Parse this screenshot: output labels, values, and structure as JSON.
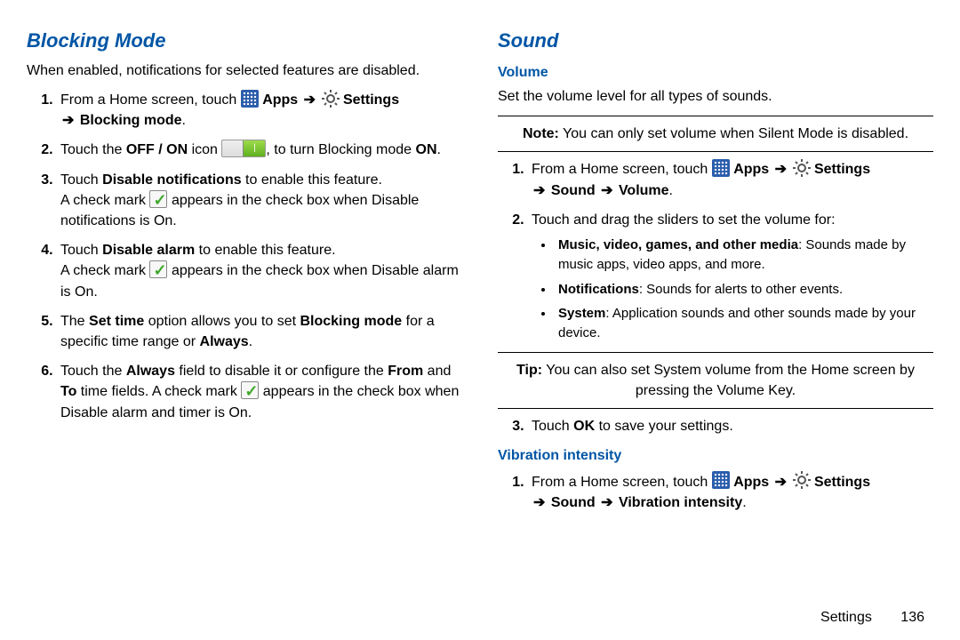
{
  "left": {
    "heading": "Blocking Mode",
    "intro": "When enabled, notifications for selected features are disabled.",
    "steps": {
      "s1a": "From a Home screen, touch ",
      "s1_apps": "Apps",
      "s1_settings": "Settings",
      "s1b": "Blocking mode",
      "s2a": "Touch the ",
      "s2_offon": "OFF / ON",
      "s2b": " icon ",
      "s2c": ", to turn Blocking mode ",
      "s2_on": "ON",
      "s3a": "Touch ",
      "s3_disable_notif": "Disable notifications",
      "s3b": " to enable this feature.",
      "s3c": "A check mark ",
      "s3d": " appears in the check box when Disable notifications is On.",
      "s4a": "Touch ",
      "s4_disable_alarm": "Disable alarm",
      "s4b": " to enable this feature.",
      "s4c": "A check mark ",
      "s4d": " appears in the check box when Disable alarm is On.",
      "s5a": "The ",
      "s5_settime": "Set time",
      "s5b": " option allows you to set ",
      "s5_bm": "Blocking mode",
      "s5c": " for a specific time range or ",
      "s5_always": "Always",
      "s6a": "Touch the ",
      "s6_always": "Always",
      "s6b": " field to disable it or configure the ",
      "s6_from": "From",
      "s6c": " and ",
      "s6_to": "To",
      "s6d": " time fields. A check mark ",
      "s6e": " appears in the check box when Disable alarm and timer is On."
    }
  },
  "right": {
    "heading": "Sound",
    "volume_heading": "Volume",
    "volume_intro": "Set the volume level for all types of sounds.",
    "note_label": "Note:",
    "note_text": " You can only set volume when Silent Mode is disabled.",
    "steps": {
      "s1a": "From a Home screen, touch ",
      "s1_apps": "Apps",
      "s1_settings": "Settings",
      "s1_sound": "Sound",
      "s1_volume": "Volume",
      "s2": "Touch and drag the sliders to set the volume for:",
      "b1_label": "Music, video, games, and other media",
      "b1_text": ": Sounds made by music apps, video apps, and more.",
      "b2_label": "Notifications",
      "b2_text": ": Sounds for alerts to other events.",
      "b3_label": "System",
      "b3_text": ": Application sounds and other sounds made by your device."
    },
    "tip_label": "Tip:",
    "tip_text": " You can also set System volume from the Home screen by pressing the Volume Key.",
    "s3a": "Touch ",
    "s3_ok": "OK",
    "s3b": " to save your settings.",
    "vibration_heading": "Vibration intensity",
    "v1a": "From a Home screen, touch ",
    "v1_apps": "Apps",
    "v1_settings": "Settings",
    "v1_sound": "Sound",
    "v1_vib": "Vibration intensity"
  },
  "footer": {
    "section": "Settings",
    "page": "136"
  }
}
